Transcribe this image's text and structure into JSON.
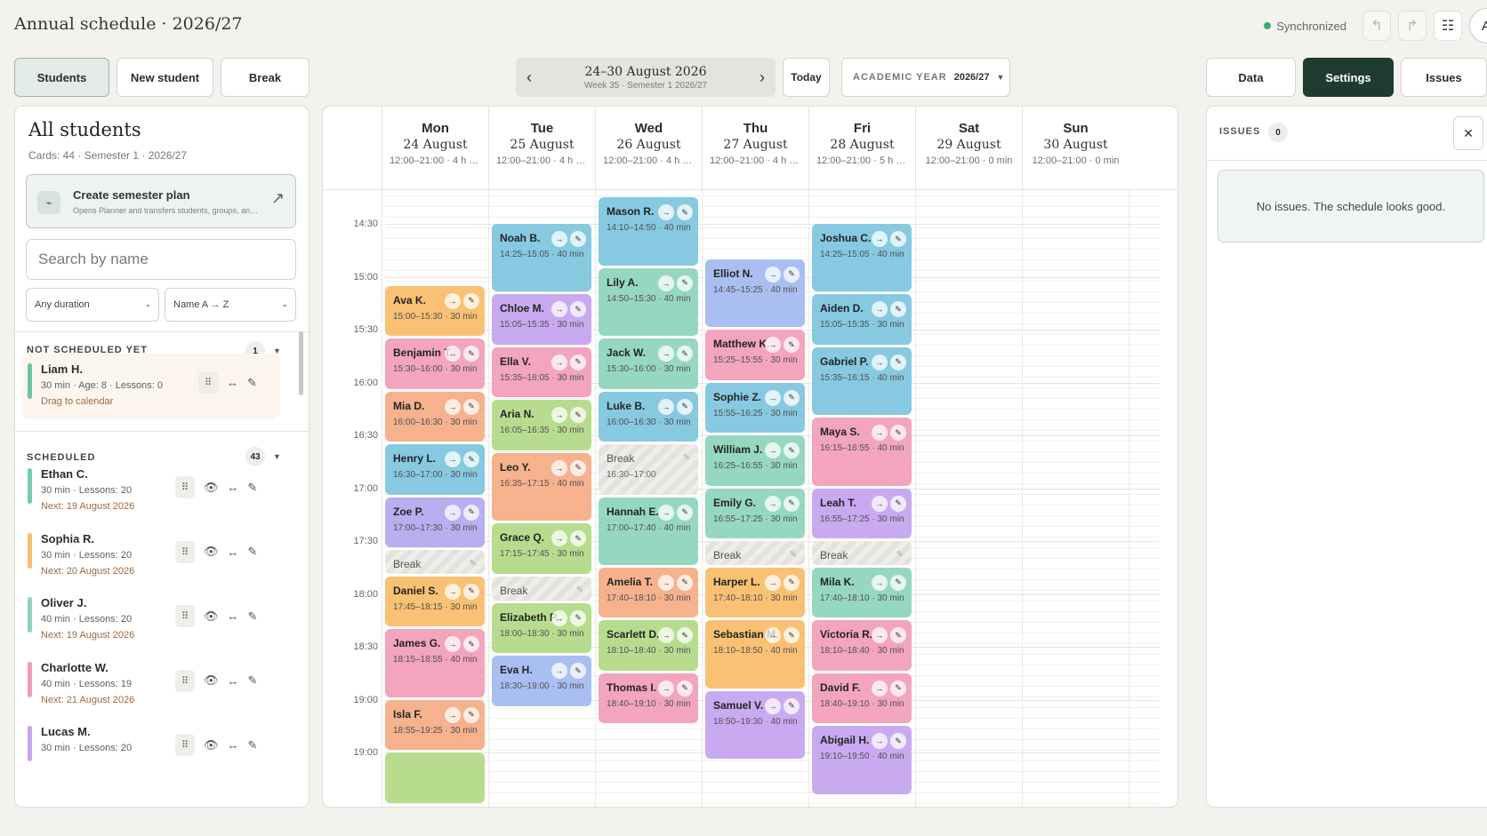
{
  "app": {
    "title": "Annual schedule · 2026/27",
    "sync_status": "Synchronized",
    "avatar": "A"
  },
  "toolbar": {
    "students": "Students",
    "new_student": "New student",
    "break": "Break",
    "week_range": "24–30 August 2026",
    "week_sub": "Week 35 · Semester 1 2026/27",
    "today": "Today",
    "academic_label": "ACADEMIC YEAR",
    "academic_value": "2026/27",
    "data": "Data",
    "settings": "Settings",
    "issues": "Issues"
  },
  "left": {
    "title": "All students",
    "subtitle": "Cards: 44 · Semester 1 · 2026/27",
    "create_title": "Create semester plan",
    "create_sub": "Opens Planner and transfers students, groups, and...",
    "search_placeholder": "Search by name",
    "duration_filter": "Any duration",
    "sort_filter": "Name A → Z",
    "not_scheduled_label": "NOT SCHEDULED YET",
    "not_scheduled_count": "1",
    "scheduled_label": "SCHEDULED",
    "scheduled_count": "43",
    "unscheduled": [
      {
        "name": "Liam H.",
        "meta": "30 min · Age: 8 · Lessons: 0",
        "note": "Drag to calendar",
        "color": "#6cc4a5"
      }
    ],
    "scheduled": [
      {
        "name": "Ethan C.",
        "meta": "30 min · Lessons: 20",
        "next": "Next: 19 August 2026",
        "color": "#74cbb4"
      },
      {
        "name": "Sophia R.",
        "meta": "30 min · Lessons: 20",
        "next": "Next: 20 August 2026",
        "color": "#f5bf6c"
      },
      {
        "name": "Oliver J.",
        "meta": "40 min · Lessons: 20",
        "next": "Next: 19 August 2026",
        "color": "#8fd4b8"
      },
      {
        "name": "Charlotte W.",
        "meta": "40 min · Lessons: 19",
        "next": "Next: 21 August 2026",
        "color": "#f19ab9"
      },
      {
        "name": "Lucas M.",
        "meta": "30 min · Lessons: 20",
        "next": "",
        "color": "#c7a6ee"
      }
    ]
  },
  "calendar": {
    "days": [
      {
        "name": "Mon",
        "date": "24 August",
        "hours": "12:00–21:00 · 4 h 5..."
      },
      {
        "name": "Tue",
        "date": "25 August",
        "hours": "12:00–21:00 · 4 h 2..."
      },
      {
        "name": "Wed",
        "date": "26 August",
        "hours": "12:00–21:00 · 4 h 3..."
      },
      {
        "name": "Thu",
        "date": "27 August",
        "hours": "12:00–21:00 · 4 h 3..."
      },
      {
        "name": "Fri",
        "date": "28 August",
        "hours": "12:00–21:00 · 5 h 1..."
      },
      {
        "name": "Sat",
        "date": "29 August",
        "hours": "12:00–21:00 · 0 min"
      },
      {
        "name": "Sun",
        "date": "30 August",
        "hours": "12:00–21:00 · 0 min"
      }
    ],
    "time_labels": [
      "14:30",
      "15:00",
      "15:30",
      "16:00",
      "16:30",
      "17:00",
      "17:30",
      "18:00",
      "18:30",
      "19:00",
      "19:00"
    ],
    "blocks": [
      {
        "day": 0,
        "name": "Ava K.",
        "time": "15:00–15:30 · 30 min",
        "color": "#f9c173"
      },
      {
        "day": 0,
        "name": "Benjamin T.",
        "time": "15:30–16:00 · 30 min",
        "color": "#f2a5bd"
      },
      {
        "day": 0,
        "name": "Mia D.",
        "time": "16:00–16:30 · 30 min",
        "color": "#f5b28d"
      },
      {
        "day": 0,
        "name": "Henry L.",
        "time": "16:30–17:00 · 30 min",
        "color": "#86c9e1"
      },
      {
        "day": 0,
        "name": "Zoe P.",
        "time": "17:00–17:30 · 30 min",
        "color": "#b9aef0"
      },
      {
        "day": 0,
        "name": "Break",
        "time": "",
        "brk": true
      },
      {
        "day": 0,
        "name": "Daniel S.",
        "time": "17:45–18:15 · 30 min",
        "color": "#f9c173"
      },
      {
        "day": 0,
        "name": "James G.",
        "time": "18:15–18:55 · 40 min",
        "color": "#f2a5bd"
      },
      {
        "day": 0,
        "name": "Isla F.",
        "time": "18:55–19:25 · 30 min",
        "color": "#f5b28d"
      },
      {
        "day": 0,
        "name": "",
        "time": "",
        "color": "#b7dc8e"
      },
      {
        "day": 1,
        "name": "Noah B.",
        "time": "14:25–15:05 · 40 min",
        "color": "#86c9e1"
      },
      {
        "day": 1,
        "name": "Chloe M.",
        "time": "15:05–15:35 · 30 min",
        "color": "#c9aaf0"
      },
      {
        "day": 1,
        "name": "Ella V.",
        "time": "15:35–16:05 · 30 min",
        "color": "#f2a5bd"
      },
      {
        "day": 1,
        "name": "Aria N.",
        "time": "16:05–16:35 · 30 min",
        "color": "#b7dc8e"
      },
      {
        "day": 1,
        "name": "Leo Y.",
        "time": "16:35–17:15 · 40 min",
        "color": "#f5b28d"
      },
      {
        "day": 1,
        "name": "Grace Q.",
        "time": "17:15–17:45 · 30 min",
        "color": "#b7dc8e"
      },
      {
        "day": 1,
        "name": "Break",
        "time": "",
        "brk": true
      },
      {
        "day": 1,
        "name": "Elizabeth P.",
        "time": "18:00–18:30 · 30 min",
        "color": "#b7dc8e"
      },
      {
        "day": 1,
        "name": "Eva H.",
        "time": "18:30–19:00 · 30 min",
        "color": "#a9bff2"
      },
      {
        "day": 2,
        "name": "Mason R.",
        "time": "14:10–14:50 · 40 min",
        "color": "#86c9e1"
      },
      {
        "day": 2,
        "name": "Lily A.",
        "time": "14:50–15:30 · 40 min",
        "color": "#96d8bf"
      },
      {
        "day": 2,
        "name": "Jack W.",
        "time": "15:30–16:00 · 30 min",
        "color": "#96d8bf"
      },
      {
        "day": 2,
        "name": "Luke B.",
        "time": "16:00–16:30 · 30 min",
        "color": "#86c9e1"
      },
      {
        "day": 2,
        "name": "Break",
        "time": "16:30–17:00",
        "brk": true
      },
      {
        "day": 2,
        "name": "Hannah E.",
        "time": "17:00–17:40 · 40 min",
        "color": "#96d8bf"
      },
      {
        "day": 2,
        "name": "Amelia T.",
        "time": "17:40–18:10 · 30 min",
        "color": "#f5b28d"
      },
      {
        "day": 2,
        "name": "Scarlett D.",
        "time": "18:10–18:40 · 30 min",
        "color": "#b7dc8e"
      },
      {
        "day": 2,
        "name": "Thomas I.",
        "time": "18:40–19:10 · 30 min",
        "color": "#f2a5bd"
      },
      {
        "day": 3,
        "name": "Elliot N.",
        "time": "14:45–15:25 · 40 min",
        "color": "#a9bff2"
      },
      {
        "day": 3,
        "name": "Matthew K.",
        "time": "15:25–15:55 · 30 min",
        "color": "#f2a5bd"
      },
      {
        "day": 3,
        "name": "Sophie Z.",
        "time": "15:55–16:25 · 30 min",
        "color": "#86c9e1"
      },
      {
        "day": 3,
        "name": "William J.",
        "time": "16:25–16:55 · 30 min",
        "color": "#96d8bf"
      },
      {
        "day": 3,
        "name": "Emily G.",
        "time": "16:55–17:25 · 30 min",
        "color": "#96d8bf"
      },
      {
        "day": 3,
        "name": "Break",
        "time": "",
        "brk": true
      },
      {
        "day": 3,
        "name": "Harper L.",
        "time": "17:40–18:10 · 30 min",
        "color": "#f9c173"
      },
      {
        "day": 3,
        "name": "Sebastian M.",
        "time": "18:10–18:50 · 40 min",
        "color": "#f9c173"
      },
      {
        "day": 3,
        "name": "Samuel V.",
        "time": "18:50–19:30 · 40 min",
        "color": "#c9aaf0"
      },
      {
        "day": 4,
        "name": "Joshua C.",
        "time": "14:25–15:05 · 40 min",
        "color": "#86c9e1"
      },
      {
        "day": 4,
        "name": "Aiden D.",
        "time": "15:05–15:35 · 30 min",
        "color": "#86c9e1"
      },
      {
        "day": 4,
        "name": "Gabriel P.",
        "time": "15:35–16:15 · 40 min",
        "color": "#86c9e1"
      },
      {
        "day": 4,
        "name": "Maya S.",
        "time": "16:15–16:55 · 40 min",
        "color": "#f2a5bd"
      },
      {
        "day": 4,
        "name": "Leah T.",
        "time": "16:55–17:25 · 30 min",
        "color": "#c9aaf0"
      },
      {
        "day": 4,
        "name": "Break",
        "time": "",
        "brk": true
      },
      {
        "day": 4,
        "name": "Mila K.",
        "time": "17:40–18:10 · 30 min",
        "color": "#96d8bf"
      },
      {
        "day": 4,
        "name": "Victoria R.",
        "time": "18:10–18:40 · 30 min",
        "color": "#f2a5bd"
      },
      {
        "day": 4,
        "name": "David F.",
        "time": "18:40–19:10 · 30 min",
        "color": "#f2a5bd"
      },
      {
        "day": 4,
        "name": "Abigail H.",
        "time": "19:10–19:50 · 40 min",
        "color": "#c9aaf0"
      }
    ]
  },
  "right": {
    "title": "ISSUES",
    "count": "0",
    "message": "No issues. The schedule looks good."
  },
  "icons": {
    "arrow": "→",
    "edit": "✎",
    "eye": "👁",
    "drag": "⠿",
    "swap": "↔"
  }
}
